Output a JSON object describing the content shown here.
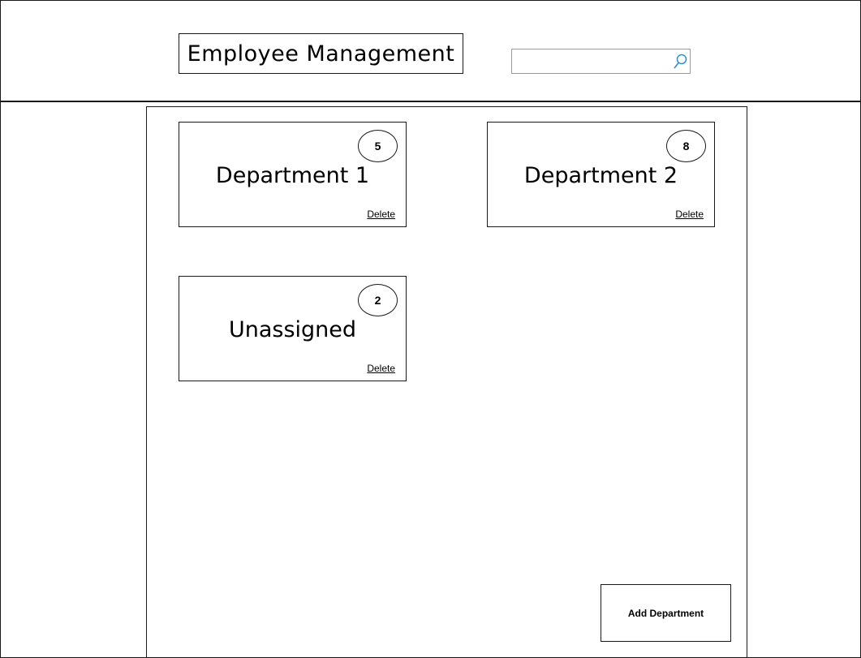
{
  "header": {
    "title": "Employee Management",
    "search": {
      "value": "",
      "placeholder": ""
    }
  },
  "departments": [
    {
      "name": "Department 1",
      "count": "5",
      "delete_label": "Delete"
    },
    {
      "name": "Department 2",
      "count": "8",
      "delete_label": "Delete"
    },
    {
      "name": "Unassigned",
      "count": "2",
      "delete_label": "Delete"
    }
  ],
  "actions": {
    "add_department_label": "Add Department"
  },
  "colors": {
    "ink": "#1a1a1a",
    "search_icon": "#2a8fc9",
    "search_border": "#9a9a9a"
  }
}
